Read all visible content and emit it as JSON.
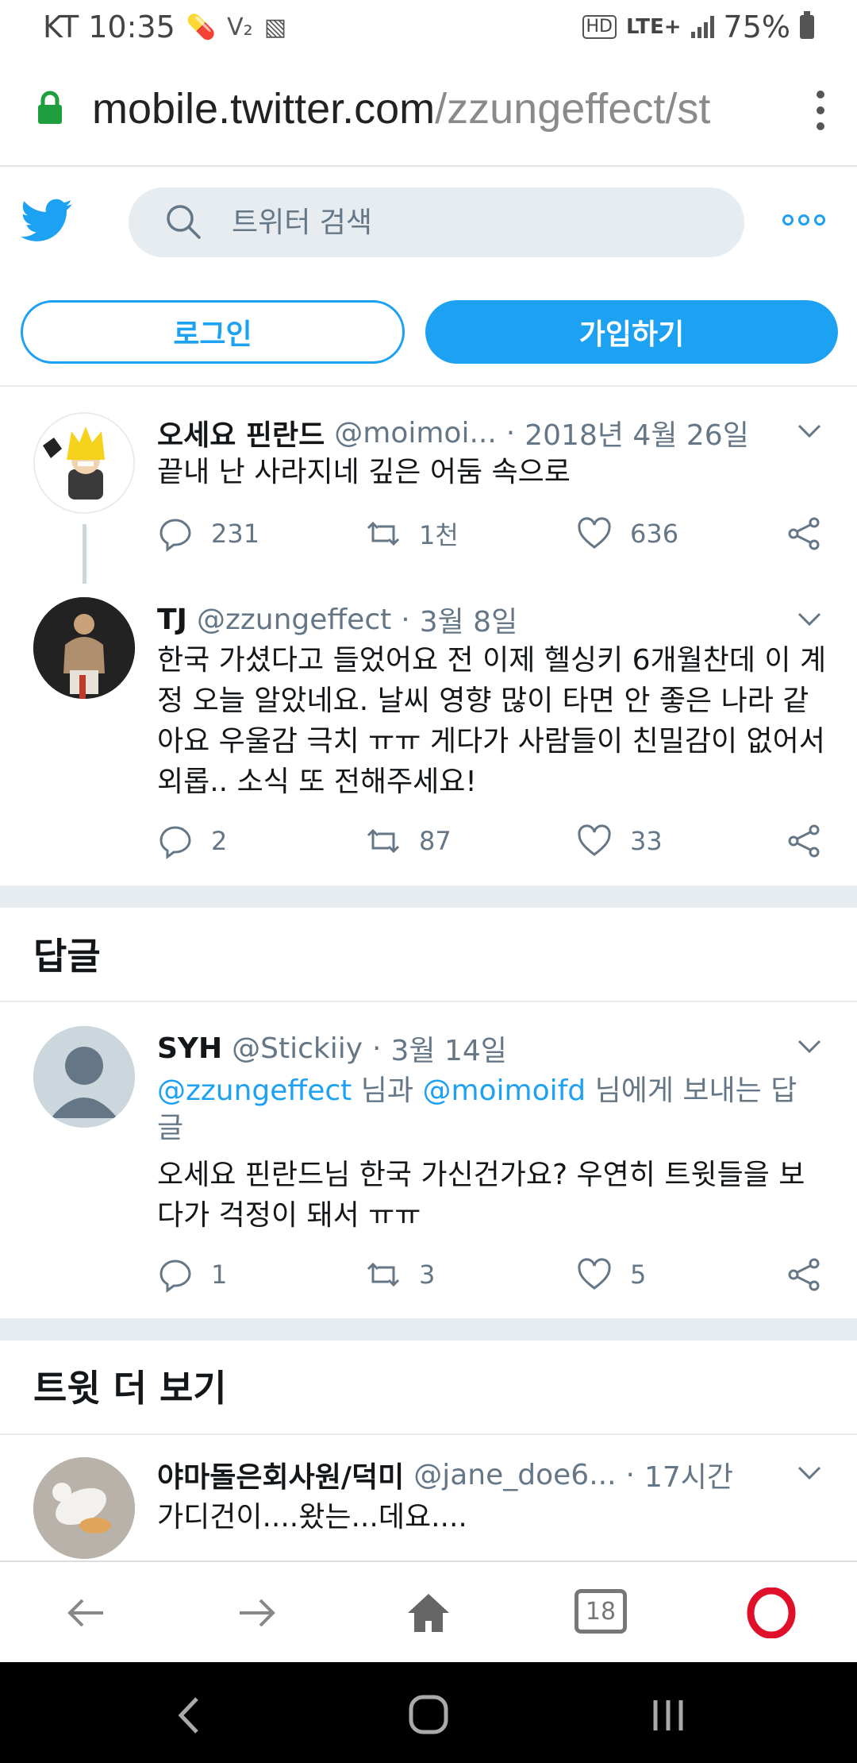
{
  "status_bar": {
    "carrier_time": "KT 10:35",
    "hd_label": "HD",
    "network_label": "LTE+",
    "battery": "75%"
  },
  "url_bar": {
    "host": "mobile.twitter.com",
    "path": "/zzungeffect/st"
  },
  "header": {
    "search_placeholder": "트위터 검색",
    "login_label": "로그인",
    "signup_label": "가입하기"
  },
  "tweets": [
    {
      "name": "오세요 핀란드",
      "handle": "@moimoi...",
      "date": "2018년 4월 26일",
      "text": "끝내 난 사라지네 깊은 어둠 속으로",
      "replies": "231",
      "retweets": "1천",
      "likes": "636"
    },
    {
      "name": "TJ",
      "handle": "@zzungeffect",
      "date": "3월 8일",
      "text": "한국 가셨다고 들었어요 전 이제 헬싱키 6개월찬데 이 계정 오늘 알았네요. 날씨 영향 많이 타면 안 좋은 나라 같아요 우울감 극치 ㅠㅠ 게다가 사람들이 친밀감이 없어서 외롭.. 소식 또 전해주세요!",
      "replies": "2",
      "retweets": "87",
      "likes": "33"
    }
  ],
  "replies_section": {
    "title": "답글",
    "tweet": {
      "name": "SYH",
      "handle": "@Stickiiy",
      "date": "3월 14일",
      "mention1": "@zzungeffect",
      "joiner1": " 님과 ",
      "mention2": "@moimoifd",
      "joiner2": " 님에게 보내는 답글",
      "text": "오세요 핀란드님 한국 가신건가요? 우연히 트윗들을 보다가 걱정이 돼서 ㅠㅠ",
      "replies": "1",
      "retweets": "3",
      "likes": "5"
    }
  },
  "more_section": {
    "title": "트윗 더 보기",
    "tweet": {
      "name": "야마돌은회사원/덕미",
      "handle": "@jane_doe6...",
      "date": "17시간",
      "text": "가디건이....왔는...데요...."
    }
  },
  "browser_nav": {
    "tabs_count": "18"
  },
  "colors": {
    "twitter_blue": "#1da1f2",
    "muted_text": "#657786",
    "separator": "#e6ecf0",
    "opera_red": "#e0102a"
  }
}
